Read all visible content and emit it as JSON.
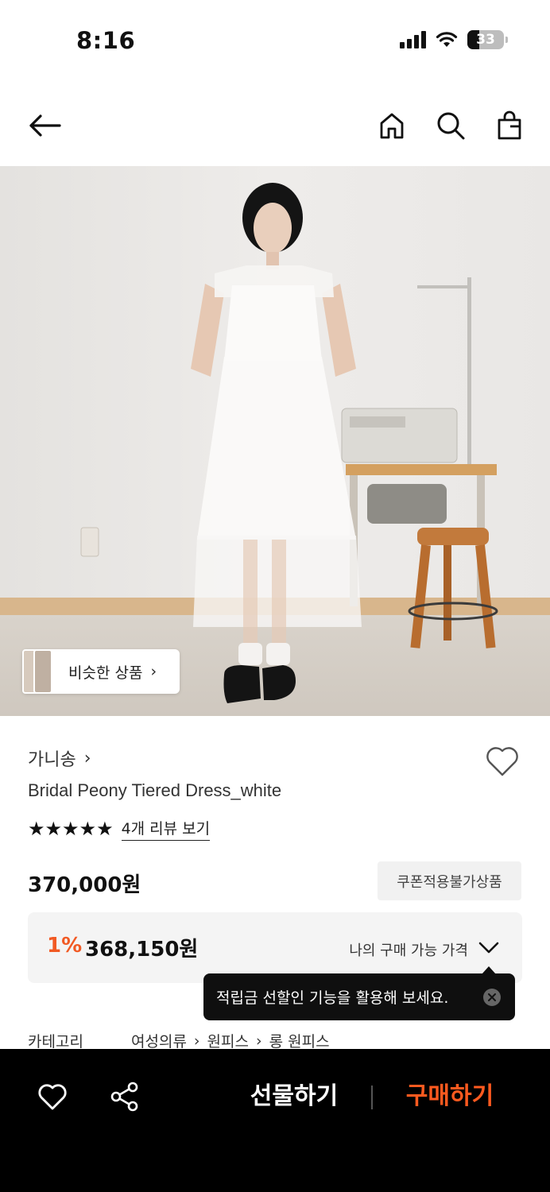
{
  "status_bar": {
    "time": "8:16",
    "battery": "33"
  },
  "hero": {
    "similar_label": "비슷한 상품",
    "similar_arrow": "›"
  },
  "product": {
    "brand": "가니송",
    "brand_arrow": "›",
    "title": "Bridal Peony Tiered Dress_white",
    "stars": "★★★★★",
    "rating_stars": 5,
    "review_link": "4개 리뷰 보기",
    "price": "370,000원",
    "coupon_badge": "쿠폰적용불가상품"
  },
  "my_price": {
    "discount": "1%",
    "price": "368,150원",
    "label": "나의 구매 가능 가격"
  },
  "tooltip": {
    "text": "적립금 선할인 기능을 활용해 보세요."
  },
  "category": {
    "label": "카테고리",
    "crumbs": [
      "여성의류",
      "원피스",
      "롱 원피스"
    ],
    "separator": "›"
  },
  "bottom_bar": {
    "gift_label": "선물하기",
    "buy_label": "구매하기"
  },
  "colors": {
    "accent": "#ff5a1f",
    "discount": "#f15a24",
    "bar": "#000000"
  }
}
